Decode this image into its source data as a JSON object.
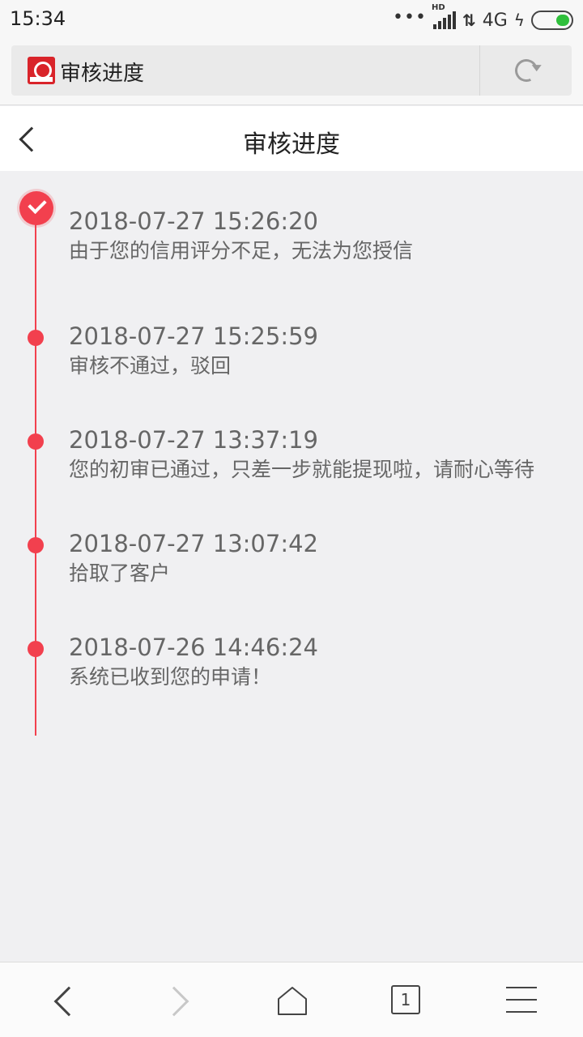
{
  "status_bar": {
    "time": "15:34",
    "network": "4G",
    "signal_label": "HD"
  },
  "browser": {
    "page_title": "审核进度"
  },
  "header": {
    "title": "审核进度"
  },
  "timeline": [
    {
      "time": "2018-07-27 15:26:20",
      "message": "由于您的信用评分不足，无法为您授信"
    },
    {
      "time": "2018-07-27 15:25:59",
      "message": "审核不通过，驳回"
    },
    {
      "time": "2018-07-27 13:37:19",
      "message": "您的初审已通过，只差一步就能提现啦，请耐心等待"
    },
    {
      "time": "2018-07-27 13:07:42",
      "message": "拾取了客户"
    },
    {
      "time": "2018-07-26 14:46:24",
      "message": "系统已收到您的申请！"
    }
  ],
  "bottom_nav": {
    "tab_count": "1"
  },
  "colors": {
    "accent": "#f2404e",
    "battery": "#2fbf3b"
  }
}
